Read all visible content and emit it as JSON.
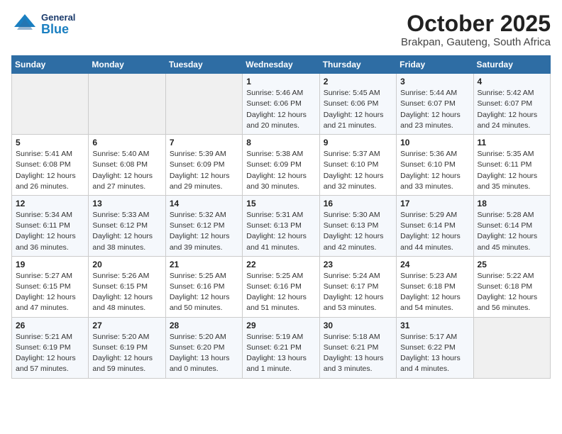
{
  "header": {
    "logo": {
      "general": "General",
      "blue": "Blue"
    },
    "month": "October 2025",
    "location": "Brakpan, Gauteng, South Africa"
  },
  "weekdays": [
    "Sunday",
    "Monday",
    "Tuesday",
    "Wednesday",
    "Thursday",
    "Friday",
    "Saturday"
  ],
  "weeks": [
    [
      {
        "day": "",
        "info": ""
      },
      {
        "day": "",
        "info": ""
      },
      {
        "day": "",
        "info": ""
      },
      {
        "day": "1",
        "info": "Sunrise: 5:46 AM\nSunset: 6:06 PM\nDaylight: 12 hours\nand 20 minutes."
      },
      {
        "day": "2",
        "info": "Sunrise: 5:45 AM\nSunset: 6:06 PM\nDaylight: 12 hours\nand 21 minutes."
      },
      {
        "day": "3",
        "info": "Sunrise: 5:44 AM\nSunset: 6:07 PM\nDaylight: 12 hours\nand 23 minutes."
      },
      {
        "day": "4",
        "info": "Sunrise: 5:42 AM\nSunset: 6:07 PM\nDaylight: 12 hours\nand 24 minutes."
      }
    ],
    [
      {
        "day": "5",
        "info": "Sunrise: 5:41 AM\nSunset: 6:08 PM\nDaylight: 12 hours\nand 26 minutes."
      },
      {
        "day": "6",
        "info": "Sunrise: 5:40 AM\nSunset: 6:08 PM\nDaylight: 12 hours\nand 27 minutes."
      },
      {
        "day": "7",
        "info": "Sunrise: 5:39 AM\nSunset: 6:09 PM\nDaylight: 12 hours\nand 29 minutes."
      },
      {
        "day": "8",
        "info": "Sunrise: 5:38 AM\nSunset: 6:09 PM\nDaylight: 12 hours\nand 30 minutes."
      },
      {
        "day": "9",
        "info": "Sunrise: 5:37 AM\nSunset: 6:10 PM\nDaylight: 12 hours\nand 32 minutes."
      },
      {
        "day": "10",
        "info": "Sunrise: 5:36 AM\nSunset: 6:10 PM\nDaylight: 12 hours\nand 33 minutes."
      },
      {
        "day": "11",
        "info": "Sunrise: 5:35 AM\nSunset: 6:11 PM\nDaylight: 12 hours\nand 35 minutes."
      }
    ],
    [
      {
        "day": "12",
        "info": "Sunrise: 5:34 AM\nSunset: 6:11 PM\nDaylight: 12 hours\nand 36 minutes."
      },
      {
        "day": "13",
        "info": "Sunrise: 5:33 AM\nSunset: 6:12 PM\nDaylight: 12 hours\nand 38 minutes."
      },
      {
        "day": "14",
        "info": "Sunrise: 5:32 AM\nSunset: 6:12 PM\nDaylight: 12 hours\nand 39 minutes."
      },
      {
        "day": "15",
        "info": "Sunrise: 5:31 AM\nSunset: 6:13 PM\nDaylight: 12 hours\nand 41 minutes."
      },
      {
        "day": "16",
        "info": "Sunrise: 5:30 AM\nSunset: 6:13 PM\nDaylight: 12 hours\nand 42 minutes."
      },
      {
        "day": "17",
        "info": "Sunrise: 5:29 AM\nSunset: 6:14 PM\nDaylight: 12 hours\nand 44 minutes."
      },
      {
        "day": "18",
        "info": "Sunrise: 5:28 AM\nSunset: 6:14 PM\nDaylight: 12 hours\nand 45 minutes."
      }
    ],
    [
      {
        "day": "19",
        "info": "Sunrise: 5:27 AM\nSunset: 6:15 PM\nDaylight: 12 hours\nand 47 minutes."
      },
      {
        "day": "20",
        "info": "Sunrise: 5:26 AM\nSunset: 6:15 PM\nDaylight: 12 hours\nand 48 minutes."
      },
      {
        "day": "21",
        "info": "Sunrise: 5:25 AM\nSunset: 6:16 PM\nDaylight: 12 hours\nand 50 minutes."
      },
      {
        "day": "22",
        "info": "Sunrise: 5:25 AM\nSunset: 6:16 PM\nDaylight: 12 hours\nand 51 minutes."
      },
      {
        "day": "23",
        "info": "Sunrise: 5:24 AM\nSunset: 6:17 PM\nDaylight: 12 hours\nand 53 minutes."
      },
      {
        "day": "24",
        "info": "Sunrise: 5:23 AM\nSunset: 6:18 PM\nDaylight: 12 hours\nand 54 minutes."
      },
      {
        "day": "25",
        "info": "Sunrise: 5:22 AM\nSunset: 6:18 PM\nDaylight: 12 hours\nand 56 minutes."
      }
    ],
    [
      {
        "day": "26",
        "info": "Sunrise: 5:21 AM\nSunset: 6:19 PM\nDaylight: 12 hours\nand 57 minutes."
      },
      {
        "day": "27",
        "info": "Sunrise: 5:20 AM\nSunset: 6:19 PM\nDaylight: 12 hours\nand 59 minutes."
      },
      {
        "day": "28",
        "info": "Sunrise: 5:20 AM\nSunset: 6:20 PM\nDaylight: 13 hours\nand 0 minutes."
      },
      {
        "day": "29",
        "info": "Sunrise: 5:19 AM\nSunset: 6:21 PM\nDaylight: 13 hours\nand 1 minute."
      },
      {
        "day": "30",
        "info": "Sunrise: 5:18 AM\nSunset: 6:21 PM\nDaylight: 13 hours\nand 3 minutes."
      },
      {
        "day": "31",
        "info": "Sunrise: 5:17 AM\nSunset: 6:22 PM\nDaylight: 13 hours\nand 4 minutes."
      },
      {
        "day": "",
        "info": ""
      }
    ]
  ]
}
